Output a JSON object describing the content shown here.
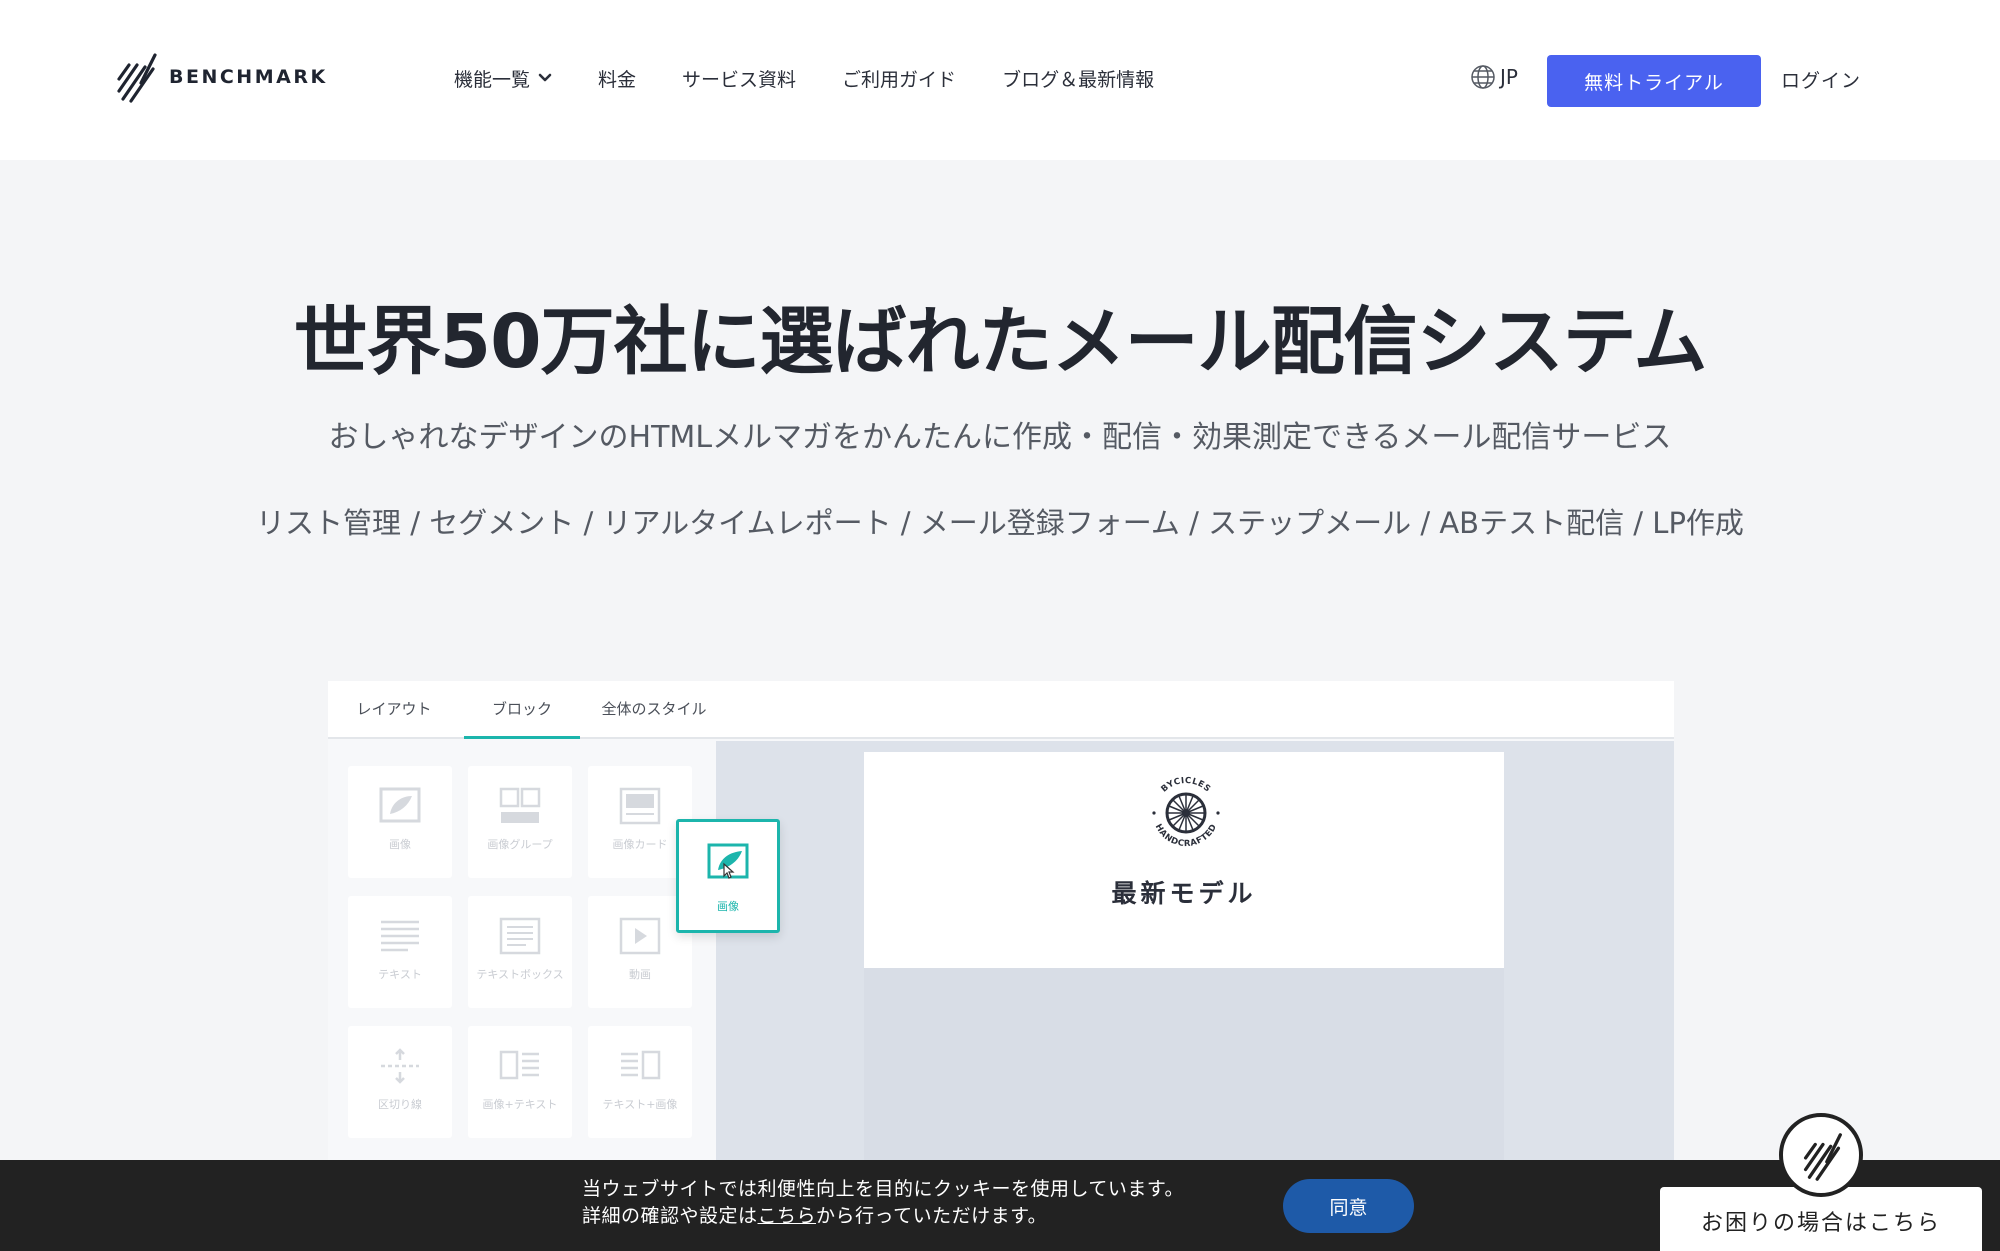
{
  "header": {
    "logo_text": "BENCHMARK",
    "nav": [
      {
        "label": "機能一覧"
      },
      {
        "label": "料金"
      },
      {
        "label": "サービス資料"
      },
      {
        "label": "ご利用ガイド"
      },
      {
        "label": "ブログ＆最新情報"
      }
    ],
    "lang": "JP",
    "trial_label": "無料トライアル",
    "login_label": "ログイン"
  },
  "hero": {
    "title": "世界50万社に選ばれたメール配信システム",
    "subtitle": "おしゃれなデザインのHTMLメルマガをかんたんに作成・配信・効果測定できるメール配信サービス",
    "features": "リスト管理 / セグメント / リアルタイムレポート / メール登録フォーム / ステップメール / ABテスト配信 / LP作成"
  },
  "editor": {
    "tabs": [
      {
        "label": "レイアウト"
      },
      {
        "label": "ブロック"
      },
      {
        "label": "全体のスタイル"
      }
    ],
    "blocks": [
      {
        "label": "画像",
        "icon": "image-icon"
      },
      {
        "label": "画像グループ",
        "icon": "image-group-icon"
      },
      {
        "label": "画像カード",
        "icon": "image-card-icon"
      },
      {
        "label": "テキスト",
        "icon": "text-icon"
      },
      {
        "label": "テキストボックス",
        "icon": "text-box-icon"
      },
      {
        "label": "動画",
        "icon": "video-icon"
      },
      {
        "label": "区切り線",
        "icon": "divider-icon"
      },
      {
        "label": "画像+テキスト",
        "icon": "image-text-icon"
      },
      {
        "label": "テキスト+画像",
        "icon": "text-image-icon"
      }
    ],
    "dragging_block_label": "画像",
    "email_title": "最新モデル",
    "seal_top": "BYCICLES",
    "seal_bottom": "HANDCRAFTED"
  },
  "cookie": {
    "line1": "当ウェブサイトでは利便性向上を目的にクッキーを使用しています。",
    "line2_pre": "詳細の確認や設定は",
    "line2_link": "こちら",
    "line2_post": "から行っていただけます。",
    "agree_label": "同意"
  },
  "help": {
    "label": "お困りの場合はこちら"
  },
  "colors": {
    "accent": "#4a62f0",
    "teal": "#1cb5ac",
    "agree": "#1e5aa8"
  }
}
